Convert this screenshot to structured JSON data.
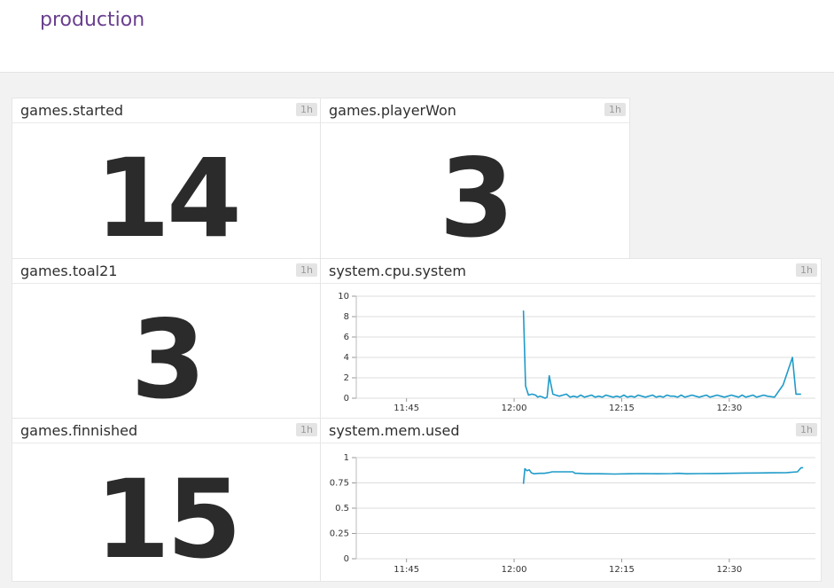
{
  "dashboard": {
    "title": "production"
  },
  "widgets": {
    "games_started": {
      "title": "games.started",
      "badge": "1h",
      "value": "14"
    },
    "games_playerwon": {
      "title": "games.playerWon",
      "badge": "1h",
      "value": "3"
    },
    "games_toal21": {
      "title": "games.toal21",
      "badge": "1h",
      "value": "3"
    },
    "games_finnished": {
      "title": "games.finnished",
      "badge": "1h",
      "value": "15"
    },
    "cpu": {
      "title": "system.cpu.system",
      "badge": "1h"
    },
    "mem": {
      "title": "system.mem.used",
      "badge": "1h"
    }
  },
  "colors": {
    "line": "#1f9bc9",
    "grid": "#dcdcdc",
    "title": "#6a3f8f"
  },
  "chart_data": [
    {
      "id": "cpu",
      "type": "line",
      "title": "system.cpu.system",
      "xlim": [
        0,
        64
      ],
      "ylim": [
        0,
        10
      ],
      "xticks": [
        {
          "label": "11:45",
          "pos": 7
        },
        {
          "label": "12:00",
          "pos": 22
        },
        {
          "label": "12:15",
          "pos": 37
        },
        {
          "label": "12:30",
          "pos": 52
        }
      ],
      "yticks": [
        {
          "label": "0",
          "value": 0
        },
        {
          "label": "2",
          "value": 2
        },
        {
          "label": "4",
          "value": 4
        },
        {
          "label": "6",
          "value": 6
        },
        {
          "label": "8",
          "value": 8
        },
        {
          "label": "10",
          "value": 10
        }
      ],
      "series": [
        {
          "x": [
            23.3,
            23.6,
            24.0,
            24.5,
            25.0,
            25.3,
            25.6,
            26.0,
            26.3,
            26.6,
            26.9,
            27.4,
            27.8,
            28.3,
            28.8,
            29.3,
            29.8,
            30.3,
            30.8,
            31.3,
            31.8,
            32.3,
            32.8,
            33.3,
            33.8,
            34.3,
            34.8,
            35.3,
            35.8,
            36.3,
            36.8,
            37.3,
            37.8,
            38.3,
            38.8,
            39.3,
            39.8,
            40.3,
            40.8,
            41.3,
            41.8,
            42.3,
            42.8,
            43.3,
            43.8,
            44.3,
            44.8,
            45.3,
            45.8,
            46.3,
            46.8,
            47.3,
            47.8,
            48.3,
            48.8,
            49.3,
            49.8,
            50.3,
            50.8,
            51.3,
            51.8,
            52.3,
            52.8,
            53.3,
            53.8,
            54.3,
            54.8,
            55.3,
            55.8,
            56.3,
            56.8,
            57.3,
            58.3,
            59.5,
            60.8,
            61.3,
            62.0
          ],
          "y": [
            8.6,
            1.2,
            0.3,
            0.4,
            0.3,
            0.1,
            0.2,
            0.1,
            0.0,
            0.1,
            2.2,
            0.4,
            0.3,
            0.2,
            0.3,
            0.4,
            0.1,
            0.2,
            0.1,
            0.3,
            0.1,
            0.2,
            0.3,
            0.1,
            0.2,
            0.1,
            0.3,
            0.2,
            0.1,
            0.2,
            0.1,
            0.3,
            0.1,
            0.2,
            0.1,
            0.3,
            0.2,
            0.1,
            0.2,
            0.3,
            0.1,
            0.2,
            0.1,
            0.3,
            0.2,
            0.2,
            0.1,
            0.3,
            0.1,
            0.2,
            0.3,
            0.2,
            0.1,
            0.2,
            0.3,
            0.1,
            0.2,
            0.3,
            0.2,
            0.1,
            0.2,
            0.3,
            0.2,
            0.1,
            0.3,
            0.1,
            0.2,
            0.3,
            0.1,
            0.2,
            0.3,
            0.2,
            0.1,
            1.3,
            4.0,
            0.4,
            0.4
          ]
        }
      ]
    },
    {
      "id": "mem",
      "type": "line",
      "title": "system.mem.used",
      "xlim": [
        0,
        64
      ],
      "ylim": [
        0,
        1
      ],
      "xticks": [
        {
          "label": "11:45",
          "pos": 7
        },
        {
          "label": "12:00",
          "pos": 22
        },
        {
          "label": "12:15",
          "pos": 37
        },
        {
          "label": "12:30",
          "pos": 52
        }
      ],
      "yticks": [
        {
          "label": "0",
          "value": 0
        },
        {
          "label": "0.25",
          "value": 0.25
        },
        {
          "label": "0.5",
          "value": 0.5
        },
        {
          "label": "0.75",
          "value": 0.75
        },
        {
          "label": "1",
          "value": 1
        }
      ],
      "series": [
        {
          "x": [
            23.3,
            23.5,
            23.8,
            24.1,
            24.4,
            24.8,
            25.5,
            26.2,
            26.7,
            27.3,
            28.0,
            29.0,
            30.2,
            30.5,
            31.0,
            32.0,
            34.0,
            36.0,
            38.0,
            40.0,
            42.0,
            44.0,
            45.0,
            46.0,
            48.0,
            50.0,
            52.0,
            54.0,
            56.0,
            58.0,
            60.0,
            61.5,
            62.0,
            62.3
          ],
          "y": [
            0.74,
            0.89,
            0.87,
            0.88,
            0.85,
            0.84,
            0.845,
            0.845,
            0.85,
            0.86,
            0.86,
            0.86,
            0.86,
            0.845,
            0.845,
            0.84,
            0.84,
            0.838,
            0.84,
            0.842,
            0.84,
            0.842,
            0.845,
            0.84,
            0.842,
            0.843,
            0.845,
            0.847,
            0.848,
            0.85,
            0.852,
            0.86,
            0.9,
            0.9
          ]
        }
      ]
    }
  ]
}
